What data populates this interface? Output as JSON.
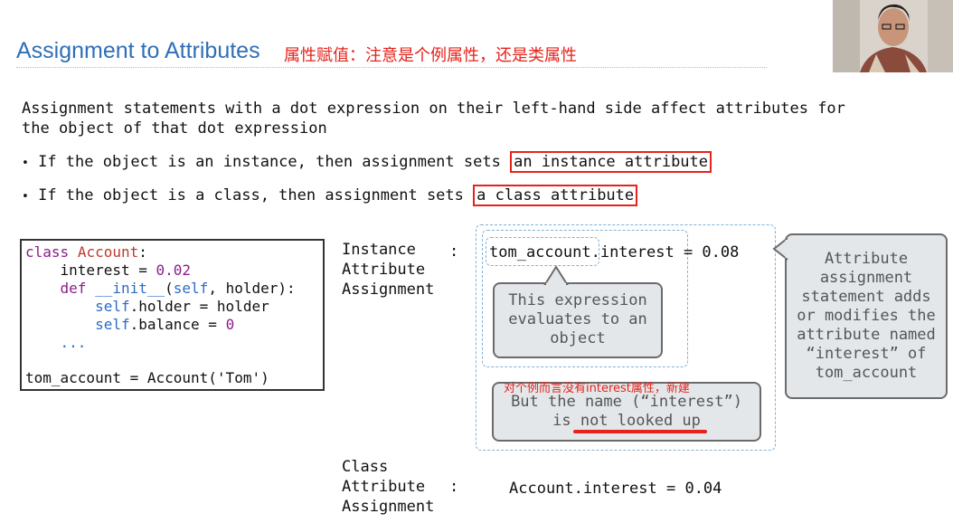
{
  "slide": {
    "title": "Assignment to Attributes",
    "title_cn": "属性赋值：注意是个例属性，还是类属性",
    "intro_line1": "Assignment statements with a dot expression on their left-hand side affect attributes for",
    "intro_line2": "the object of that dot expression",
    "bullets": [
      {
        "marker": "•",
        "text": "If the object is an instance, then assignment sets",
        "highlight": "an instance attribute"
      },
      {
        "marker": "•",
        "text": "If the object is a class, then assignment sets",
        "highlight": "a class attribute"
      }
    ],
    "code": {
      "line1_kw": "class",
      "line1_name": "Account",
      "line1_colon": ":",
      "line2_pre": "interest = ",
      "line2_num": "0.02",
      "line3_kw": "def",
      "line3_fn": "__init__",
      "line3_open": "(",
      "line3_self": "self",
      "line3_rest": ", holder):",
      "line4_self": "self",
      "line4_rest": ".holder = holder",
      "line5_self": "self",
      "line5_rest": ".balance = ",
      "line5_num": "0",
      "line6": "...",
      "line7": "tom_account = Account('Tom')"
    },
    "instance_label": [
      "Instance",
      "Attribute",
      "Assignment"
    ],
    "instance_colon": ":",
    "instance_expr_obj": "tom_account",
    "instance_expr_rest": ".interest = 0.08",
    "bubble_eval": [
      "This expression",
      "evaluates to an",
      "object"
    ],
    "cn_annotation": "对个例而言没有interest属性，新建",
    "bubble_name_line1": "But the name (“interest”)",
    "bubble_name_is": "is ",
    "bubble_name_underlined": "not looked up",
    "side_note": [
      "Attribute",
      "assignment",
      "statement adds",
      "or modifies the",
      "attribute named",
      "“interest” of",
      "tom_account"
    ],
    "class_label": [
      "Class",
      "Attribute",
      "Assignment"
    ],
    "class_colon": ":",
    "class_expr": "Account.interest = 0.04"
  },
  "colors": {
    "title": "#2f6fb7",
    "annotation_red": "#e5231b",
    "keyword": "#8b1d8b",
    "self": "#2b6cc4",
    "bubble_bg": "#e4e7ea"
  },
  "icons": {
    "webcam": "presenter-webcam-feed"
  }
}
